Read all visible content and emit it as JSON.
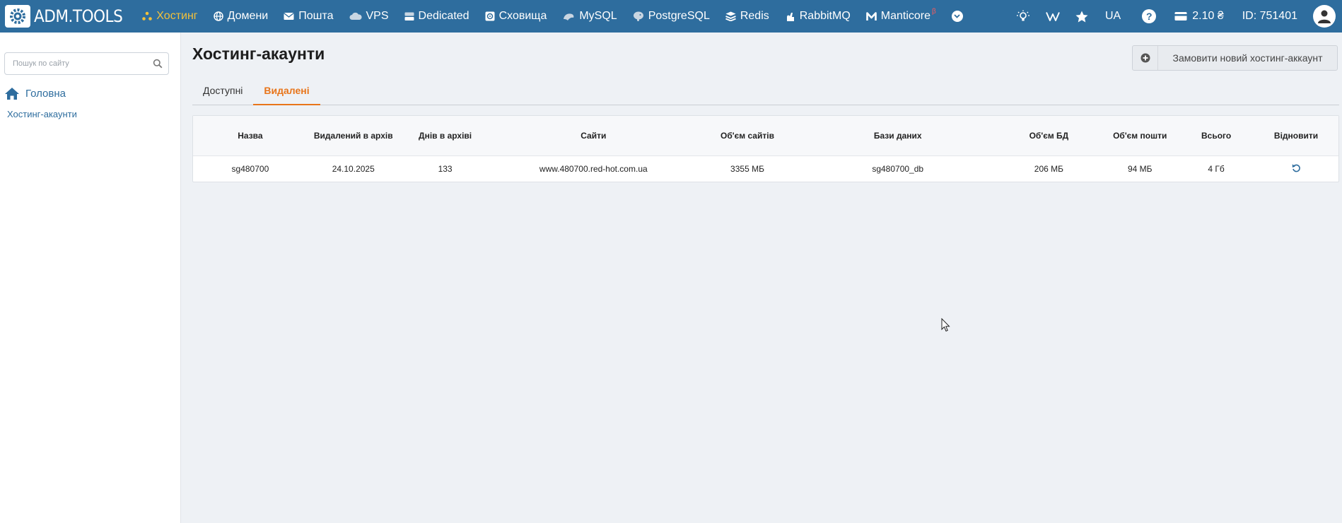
{
  "logo": {
    "text": "ADM.TOOLS"
  },
  "nav": {
    "items": [
      {
        "label": "Хостинг",
        "icon": "hosting-icon",
        "active": true
      },
      {
        "label": "Домени",
        "icon": "globe-icon"
      },
      {
        "label": "Пошта",
        "icon": "mail-icon"
      },
      {
        "label": "VPS",
        "icon": "cloud-icon"
      },
      {
        "label": "Dedicated",
        "icon": "server-icon"
      },
      {
        "label": "Сховища",
        "icon": "storage-icon"
      },
      {
        "label": "MySQL",
        "icon": "mysql-icon"
      },
      {
        "label": "PostgreSQL",
        "icon": "postgresql-icon"
      },
      {
        "label": "Redis",
        "icon": "redis-icon"
      },
      {
        "label": "RabbitMQ",
        "icon": "rabbitmq-icon"
      },
      {
        "label": "Manticore",
        "icon": "manticore-icon",
        "badge": "β"
      }
    ],
    "accent_color": "#f3c13a",
    "bar_color": "#2e6d9e"
  },
  "tools": {
    "lang": "UA",
    "help": "?",
    "balance": "2.10 ₴",
    "account_id": "ID: 751401"
  },
  "sidebar": {
    "search_placeholder": "Пошук по сайту",
    "home_label": "Головна",
    "sub_label": "Хостинг-акаунти"
  },
  "main": {
    "title": "Хостинг-акаунти",
    "order_button": "Замовити новий хостинг-аккаунт",
    "tabs": [
      {
        "label": "Доступні",
        "active": false
      },
      {
        "label": "Видалені",
        "active": true
      }
    ],
    "tab_accent_color": "#e8751a",
    "table": {
      "headers": [
        "Назва",
        "Видалений в архів",
        "Днів в архіві",
        "Сайти",
        "Об'єм сайтів",
        "Бази даних",
        "Об'єм БД",
        "Об'єм пошти",
        "Всього",
        "Відновити"
      ],
      "rows": [
        [
          "sg480700",
          "24.10.2025",
          "133",
          "www.480700.red-hot.com.ua",
          "3355 МБ",
          "sg480700_db",
          "206 МБ",
          "94 МБ",
          "4 Гб"
        ]
      ]
    }
  }
}
